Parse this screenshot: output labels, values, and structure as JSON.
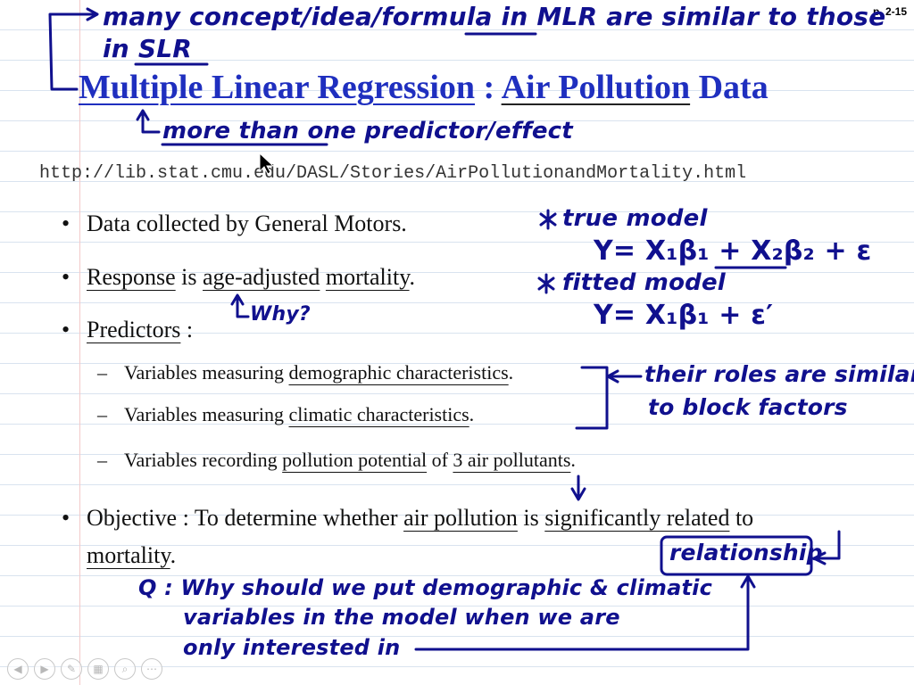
{
  "page_number": "p. 2-15",
  "title": {
    "part1": "Multiple Linear Regression",
    "sep": " : ",
    "part2": "Air Pollution",
    "part3": " Data"
  },
  "url": "http://lib.stat.cmu.edu/DASL/Stories/AirPollutionandMortality.html",
  "bullets": {
    "b1": "Data collected by General Motors.",
    "b2": {
      "a": "Response",
      "b": " is ",
      "c": "age-adjusted",
      "d": " ",
      "e": "mortality",
      "f": "."
    },
    "b3": {
      "a": "Predictors",
      "b": " :"
    },
    "s1": {
      "a": "Variables measuring ",
      "b": "demographic characteristics",
      "c": "."
    },
    "s2": {
      "a": "Variables measuring ",
      "b": "climatic characteristics",
      "c": "."
    },
    "s3": {
      "a": "Variables recording ",
      "b": "pollution potential",
      "c": " of ",
      "d": "3 air pollutants",
      "e": "."
    },
    "b4": {
      "a": "Objective : To determine whether ",
      "b": "air pollution",
      "c": " is ",
      "d": "significantly related",
      "e": " to",
      "f": "mortality",
      "g": "."
    }
  },
  "annotations": {
    "top_line1": "many concept/idea/formula in MLR are similar to those",
    "top_line2": "in SLR",
    "more_than_one": "more than one predictor/effect",
    "why": "Why?",
    "true_model": "true model",
    "true_eq": "Y= X₁β₁ + X₂β₂ + ε",
    "fitted_model": "fitted model",
    "fitted_eq": "Y= X₁β₁ + ε′",
    "roles1": "their roles are similar",
    "roles2": "to block factors",
    "relationship": "relationship",
    "q1": "Q : Why should we put demographic & climatic",
    "q2": "variables in the model when we are",
    "q3": "only interested in"
  },
  "toolbar": [
    "prev-icon",
    "next-icon",
    "pen-icon",
    "grid-icon",
    "zoom-icon",
    "more-icon"
  ],
  "colors": {
    "ink": "#10108e",
    "title": "#1f2fbf"
  }
}
